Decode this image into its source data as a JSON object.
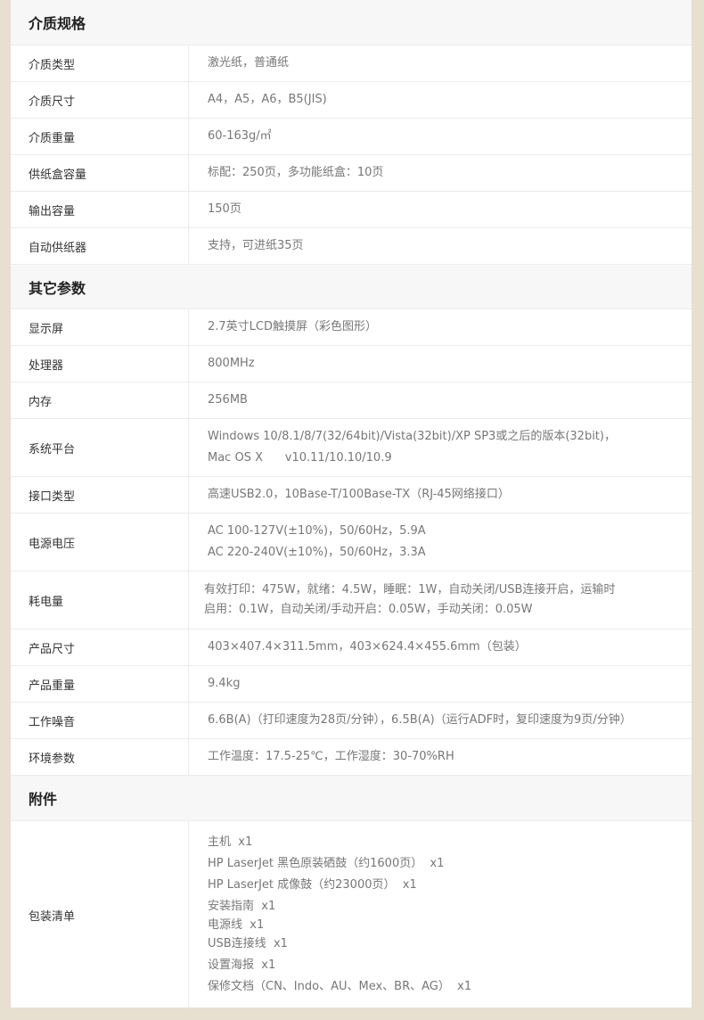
{
  "sections": [
    {
      "title": "介质规格",
      "rows": [
        {
          "label": "介质类型",
          "lines": [
            "激光纸，普通纸"
          ]
        },
        {
          "label": "介质尺寸",
          "lines": [
            "A4，A5，A6，B5(JIS)"
          ]
        },
        {
          "label": "介质重量",
          "lines": [
            "60-163g/㎡"
          ]
        },
        {
          "label": "供纸盒容量",
          "lines": [
            "标配：250页，多功能纸盒：10页"
          ]
        },
        {
          "label": "输出容量",
          "lines": [
            "150页"
          ]
        },
        {
          "label": "自动供纸器",
          "lines": [
            "支持，可进纸35页"
          ]
        }
      ]
    },
    {
      "title": "其它参数",
      "rows": [
        {
          "label": "显示屏",
          "lines": [
            "2.7英寸LCD触摸屏（彩色图形）"
          ]
        },
        {
          "label": "处理器",
          "lines": [
            "800MHz"
          ]
        },
        {
          "label": "内存",
          "lines": [
            "256MB"
          ]
        },
        {
          "label": "系统平台",
          "lines": [
            "Windows 10/8.1/8/7(32/64bit)/Vista(32bit)/XP SP3或之后的版本(32bit)，",
            "Mac OS X      v10.11/10.10/10.9"
          ]
        },
        {
          "label": "接口类型",
          "lines": [
            "高速USB2.0，10Base-T/100Base-TX（RJ-45网络接口）"
          ]
        },
        {
          "label": "电源电压",
          "lines": [
            "AC 100-127V(±10%)，50/60Hz，5.9A",
            "AC 220-240V(±10%)，50/60Hz，3.3A"
          ]
        },
        {
          "label": "耗电量",
          "lines": [
            "有效打印：475W，就绪：4.5W，睡眠：1W，自动关闭/USB连接开启，运输时",
            "启用：0.1W，自动关闭/手动开启：0.05W，手动关闭：0.05W"
          ]
        },
        {
          "label": "产品尺寸",
          "lines": [
            "403×407.4×311.5mm，403×624.4×455.6mm（包装）"
          ]
        },
        {
          "label": "产品重量",
          "lines": [
            "9.4kg"
          ]
        },
        {
          "label": "工作噪音",
          "lines": [
            "6.6B(A)（打印速度为28页/分钟），6.5B(A)（运行ADF时，复印速度为9页/分钟）"
          ]
        },
        {
          "label": "环境参数",
          "lines": [
            "工作温度：17.5-25℃，工作湿度：30-70%RH"
          ]
        }
      ]
    },
    {
      "title": "附件",
      "rows": [
        {
          "label": "包装清单",
          "lines": [
            "主机  x1",
            "HP LaserJet 黑色原装硒鼓（约1600页）  x1",
            "HP LaserJet 成像鼓（约23000页）  x1",
            "安装指南  x1",
            "电源线  x1",
            "USB连接线  x1",
            "设置海报  x1",
            "保修文档（CN、Indo、AU、Mex、BR、AG）  x1"
          ]
        }
      ]
    }
  ]
}
